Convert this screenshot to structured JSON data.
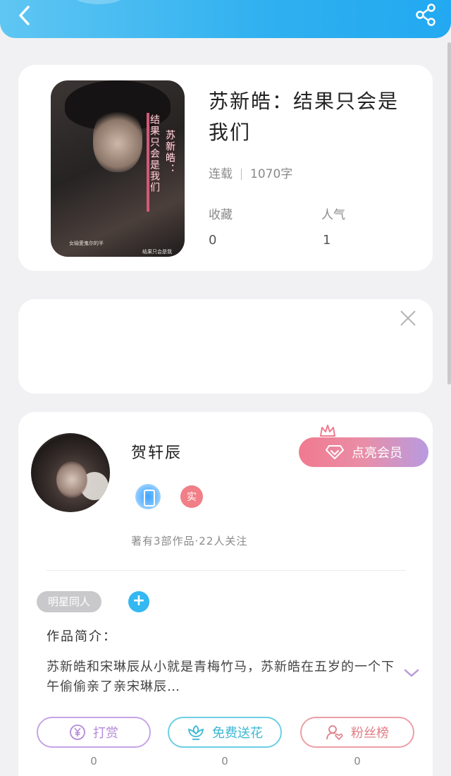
{
  "header": {
    "back_icon": "chevron-left-icon",
    "share_icon": "share-icon",
    "gradient_start": "#5fc6f2",
    "gradient_end": "#22a9f1"
  },
  "book": {
    "cover_title_line1": "结果只会是我们",
    "cover_title_line2": "苏新皓：",
    "cover_small_text_1": "女喻愛鬼尔的半",
    "cover_small_text_2": "结果只会是我",
    "title": "苏新皓：结果只会是我们",
    "status": "连载",
    "word_count": "1070字",
    "favorites_label": "收藏",
    "favorites_value": "0",
    "popularity_label": "人气",
    "popularity_value": "1"
  },
  "ad": {
    "close_icon": "close-icon"
  },
  "author": {
    "name": "贺轩辰",
    "vip_button": "点亮会员",
    "real_badge": "实",
    "stats": "著有3部作品·22人关注",
    "tag": "明星同人",
    "tag_add": "+",
    "intro_label": "作品简介：",
    "intro_text": "苏新皓和宋琳辰从小就是青梅竹马，苏新皓在五岁的一个下午偷偷亲了亲宋琳辰…",
    "actions": [
      {
        "label": "打赏",
        "count": "0",
        "icon": "yen-coin-icon",
        "color": "#b48ad8"
      },
      {
        "label": "免费送花",
        "count": "0",
        "icon": "flower-icon",
        "color": "#3bb7d6"
      },
      {
        "label": "粉丝榜",
        "count": "0",
        "icon": "user-heart-icon",
        "color": "#e07e87"
      }
    ]
  }
}
